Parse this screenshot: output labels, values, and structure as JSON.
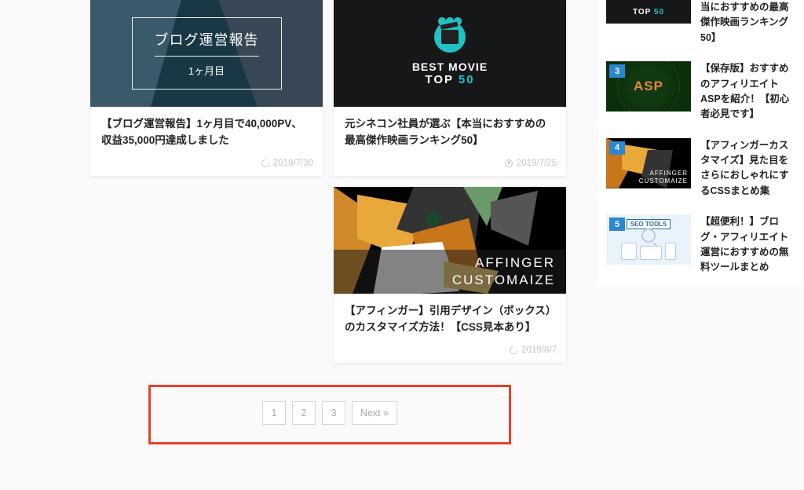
{
  "cards": [
    {
      "thumb_line1": "ブログ運営報告",
      "thumb_line2": "1ヶ月目",
      "title": "【ブログ運営報告】1ヶ月目で40,000PV、収益35,000円達成しました",
      "date": "2019/7/30",
      "meta_icon": "refresh"
    },
    {
      "thumb_line1": "BEST MOVIE",
      "thumb_line2a": "TOP ",
      "thumb_line2b": "50",
      "title": "元シネコン社員が選ぶ【本当におすすめの最高傑作映画ランキング50】",
      "date": "2019/7/25",
      "meta_icon": "clock"
    },
    {
      "thumb_line1": "AFFINGER",
      "thumb_line2": "CUSTOMAIZE",
      "title": "【アフィンガー】引用デザイン（ボックス）のカスタマイズ方法！【CSS見本あり】",
      "date": "2019/8/7",
      "meta_icon": "refresh"
    }
  ],
  "pagination": {
    "pages": [
      "1",
      "2",
      "3"
    ],
    "next": "Next »"
  },
  "sidebar": [
    {
      "badge": "",
      "thumb_text_a": "TOP ",
      "thumb_text_b": "50",
      "title": "当におすすめの最高傑作映画ランキング50】"
    },
    {
      "badge": "3",
      "thumb_text": "ASP",
      "title": "【保存版】おすすめのアフィリエイトASPを紹介！【初心者必見です】"
    },
    {
      "badge": "4",
      "thumb_text_a": "AFFINGER",
      "thumb_text_b": "CUSTOMAIZE",
      "title": "【アフィンガーカスタマイズ】見た目をさらにおしゃれにするCSSまとめ集"
    },
    {
      "badge": "5",
      "thumb_text": "SEO TOOLS",
      "title": "【超便利！】ブログ・アフィリエイト運営におすすめの無料ツールまとめ"
    }
  ]
}
